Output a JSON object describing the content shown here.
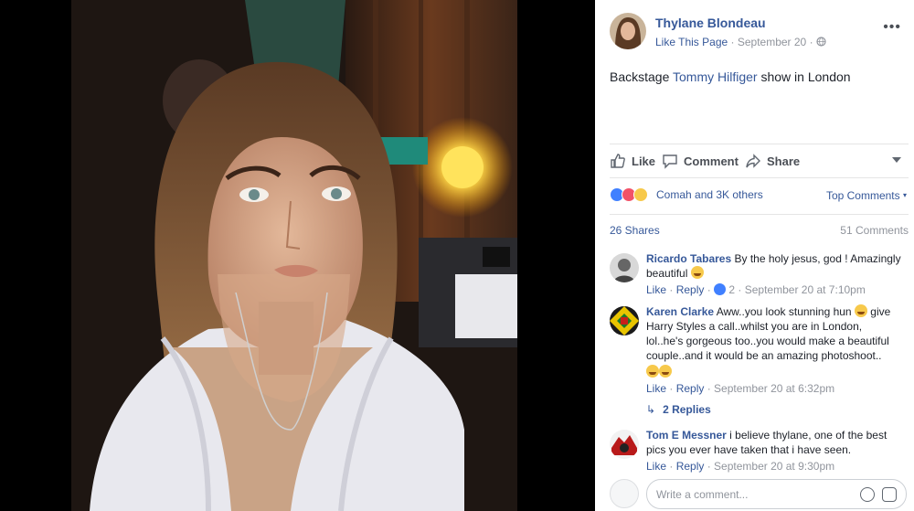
{
  "post": {
    "author": "Thylane Blondeau",
    "like_page": "Like This Page",
    "separator": " · ",
    "date": "September 20",
    "text_before": "Backstage ",
    "mention": "Tommy Hilfiger",
    "text_after": " show in London"
  },
  "actions": {
    "like": "Like",
    "comment": "Comment",
    "share": "Share"
  },
  "reactions": {
    "summary": "Comah and 3K others",
    "top_comments": "Top Comments"
  },
  "stats": {
    "shares": "26 Shares",
    "comments": "51 Comments"
  },
  "comments": [
    {
      "author": "Ricardo Tabares",
      "text": "By the holy jesus, god ! Amazingly beautiful",
      "like": "Like",
      "reply": "Reply",
      "likes": "2",
      "time": "September 20 at 7:10pm"
    },
    {
      "author": "Karen Clarke",
      "text": "Aww..you look stunning hun",
      "text2": "give Harry Styles a call..whilst you are in London, lol..he's gorgeous too..you would make a beautiful couple..and it would be an amazing photoshoot..",
      "like": "Like",
      "reply": "Reply",
      "time": "September 20 at 6:32pm",
      "replies": "2 Replies"
    },
    {
      "author": "Tom E Messner",
      "text": "i believe thylane, one of the best pics you ever have taken that i have seen.",
      "like": "Like",
      "reply": "Reply",
      "time": "September 20 at 9:30pm"
    }
  ],
  "composer": {
    "placeholder": "Write a comment..."
  },
  "colors": {
    "link": "#365899",
    "meta": "#90949c",
    "like_blue": "#4080ff",
    "love_red": "#f25268"
  },
  "icons": [
    "more-icon",
    "globe-icon",
    "like-icon",
    "comment-icon",
    "share-icon",
    "chevron-down-icon",
    "like-reaction-icon",
    "love-reaction-icon",
    "wow-reaction-icon",
    "reply-arrow-icon",
    "emoji-icon",
    "sticker-icon"
  ]
}
